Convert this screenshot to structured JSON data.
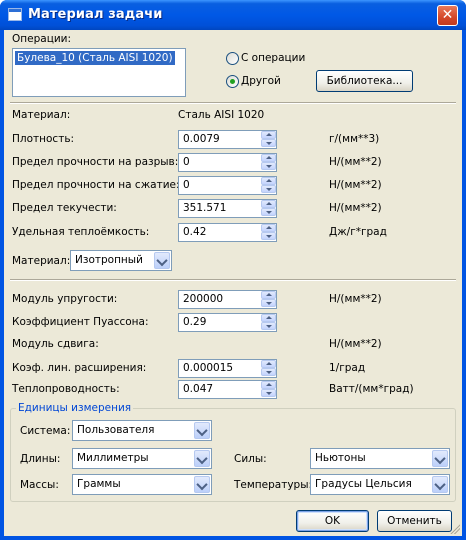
{
  "window": {
    "title": "Материал задачи",
    "close_glyph": "✕"
  },
  "operations": {
    "label": "Операции:",
    "items": [
      "Булева_10 (Сталь AISI 1020)"
    ]
  },
  "radio": {
    "from_operation": "С операции",
    "other": "Другой",
    "selected": "other"
  },
  "library_button": "Библиотека...",
  "material": {
    "label": "Материал:",
    "value": "Сталь AISI 1020"
  },
  "fields": [
    {
      "label": "Плотность:",
      "value": "0.0079",
      "unit": "г/(мм**3)"
    },
    {
      "label": "Предел прочности на разрыв:",
      "value": "0",
      "unit": "Н/(мм**2)"
    },
    {
      "label": "Предел прочности на сжатие:",
      "value": "0",
      "unit": "Н/(мм**2)"
    },
    {
      "label": "Предел текучести:",
      "value": "351.571",
      "unit": "Н/(мм**2)"
    },
    {
      "label": "Удельная теплоёмкость:",
      "value": "0.42",
      "unit": "Дж/г*град"
    }
  ],
  "material_type": {
    "label": "Материал:",
    "value": "Изотропный"
  },
  "fields2": [
    {
      "label": "Модуль упругости:",
      "value": "200000",
      "unit": "Н/(мм**2)"
    },
    {
      "label": "Коэффициент Пуассона:",
      "value": "0.29",
      "unit": ""
    },
    {
      "label": "Модуль сдвига:",
      "value": "",
      "unit": "Н/(мм**2)"
    },
    {
      "label": "Коэф. лин. расширения:",
      "value": "0.000015",
      "unit": "1/град"
    },
    {
      "label": "Теплопроводность:",
      "value": "0.047",
      "unit": "Ватт/(мм*град)"
    }
  ],
  "units": {
    "title": "Единицы измерения",
    "system": {
      "label": "Система:",
      "value": "Пользователя"
    },
    "length": {
      "label": "Длины:",
      "value": "Миллиметры"
    },
    "force": {
      "label": "Силы:",
      "value": "Ньютоны"
    },
    "mass": {
      "label": "Массы:",
      "value": "Граммы"
    },
    "temperature": {
      "label": "Температуры:",
      "value": "Градусы Цельсия"
    }
  },
  "buttons": {
    "ok": "OK",
    "cancel": "Отменить"
  }
}
